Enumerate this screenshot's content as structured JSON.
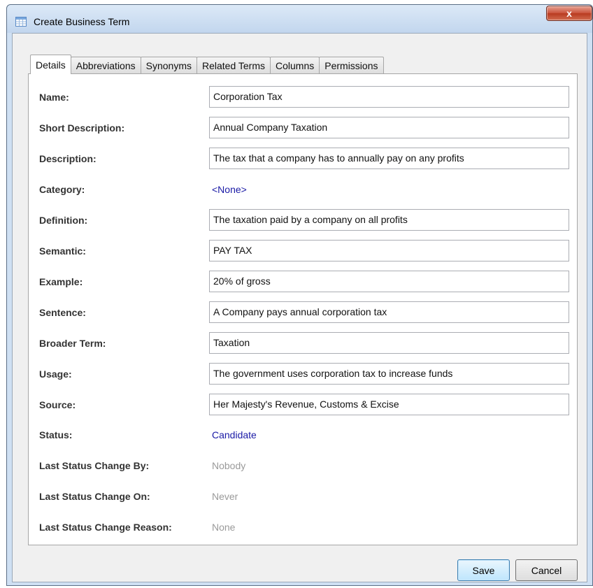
{
  "window": {
    "title": "Create Business Term",
    "close_label": "x"
  },
  "tabs": [
    {
      "label": "Details",
      "active": true
    },
    {
      "label": "Abbreviations",
      "active": false
    },
    {
      "label": "Synonyms",
      "active": false
    },
    {
      "label": "Related Terms",
      "active": false
    },
    {
      "label": "Columns",
      "active": false
    },
    {
      "label": "Permissions",
      "active": false
    }
  ],
  "form": {
    "name": {
      "label": "Name:",
      "value": "Corporation Tax"
    },
    "short_description": {
      "label": "Short Description:",
      "value": "Annual Company Taxation"
    },
    "description": {
      "label": "Description:",
      "value": "The tax that a company has to annually pay on any profits"
    },
    "category": {
      "label": "Category:",
      "value": "<None>"
    },
    "definition": {
      "label": "Definition:",
      "value": "The taxation paid by a company on all profits"
    },
    "semantic": {
      "label": "Semantic:",
      "value": "PAY TAX"
    },
    "example": {
      "label": "Example:",
      "value": "20% of gross"
    },
    "sentence": {
      "label": "Sentence:",
      "value": "A Company pays annual corporation tax"
    },
    "broader_term": {
      "label": "Broader Term:",
      "value": "Taxation"
    },
    "usage": {
      "label": "Usage:",
      "value": "The government uses corporation tax to increase funds"
    },
    "source": {
      "label": "Source:",
      "value": "Her Majesty's Revenue, Customs & Excise"
    },
    "status": {
      "label": "Status:",
      "value": "Candidate"
    },
    "last_status_change_by": {
      "label": "Last Status Change By:",
      "value": "Nobody"
    },
    "last_status_change_on": {
      "label": "Last Status Change On:",
      "value": "Never"
    },
    "last_status_change_reason": {
      "label": "Last Status Change Reason:",
      "value": "None"
    }
  },
  "buttons": {
    "save": "Save",
    "cancel": "Cancel"
  },
  "colors": {
    "link": "#1a1aa6",
    "muted": "#9a9a9a"
  }
}
